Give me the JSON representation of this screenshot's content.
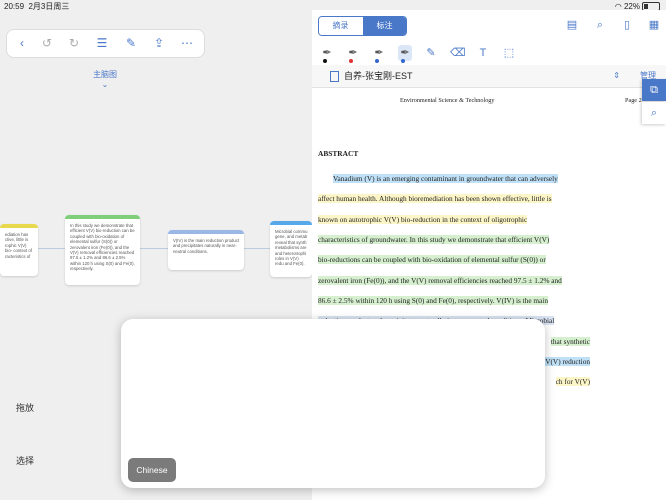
{
  "status_bar": {
    "time": "20:59",
    "date": "2月3日周三",
    "battery": "22%"
  },
  "mindmap": {
    "title": "主脑图",
    "nodes": [
      {
        "text": "ediation has ctive, little is rophic V(V) bio- context of racteristics of",
        "color": "#e8d84c"
      },
      {
        "text": "In this study we demonstrate that efficient V(V) bio-reduction can be coupled with bio-oxidation of elemental sulfur (S(0)) or zerovalent iron (Fe(0)), and the V(V) removal efficiencies reached 97.5 ± 1.2% and 86.6 ± 2.5% within 120 h using S(0) and Fe(0), respectively.",
        "color": "#7fcf7a"
      },
      {
        "text": "V(IV) is the main reduction product and precipitates naturally in near-neutral conditions.",
        "color": "#9ab7e6"
      },
      {
        "text": "Microbial commu gene, and metab reveal that synth metabolisms are and heterotrophi roles in V(V) redu and Fe(0).",
        "color": "#57a8e8"
      }
    ],
    "buttons": [
      "拖放",
      "选择"
    ]
  },
  "annot": {
    "tabs": [
      "摘录",
      "标注"
    ],
    "doc_title": "自养-张宝刚-EST",
    "manage": "管理",
    "journal": "Environmental Science & Technology",
    "page": "Page 2",
    "heading": "ABSTRACT",
    "lines": [
      "Vanadium (V) is an emerging contaminant in groundwater that can adversely",
      "affect human health. Although bioremediation has been shown effective, little is",
      "known on autotrophic V(V) bio-reduction in the context of oligotrophic",
      "characteristics of groundwater. In this study we demonstrate that efficient V(V)",
      "bio-reductions can be coupled with bio-oxidation of elemental sulfur (S(0)) or",
      "zerovalent iron (Fe(0)), and the V(V) removal efficiencies reached 97.5 ± 1.2% and",
      "86.6 ± 2.5% within 120 h using S(0) and Fe(0), respectively. V(IV) is the main",
      "reduction product and precipitates naturally in near-neutral conditions. Microbial",
      "that synthetic",
      "V(V) reduction",
      "ch for V(V)"
    ]
  },
  "popup": {
    "language_button": "Chinese"
  },
  "colors": {
    "accent": "#4a78c8",
    "highlight_blue": "#bfe0f6",
    "highlight_yellow": "#fbf5c7",
    "highlight_green": "#d5efcf"
  }
}
